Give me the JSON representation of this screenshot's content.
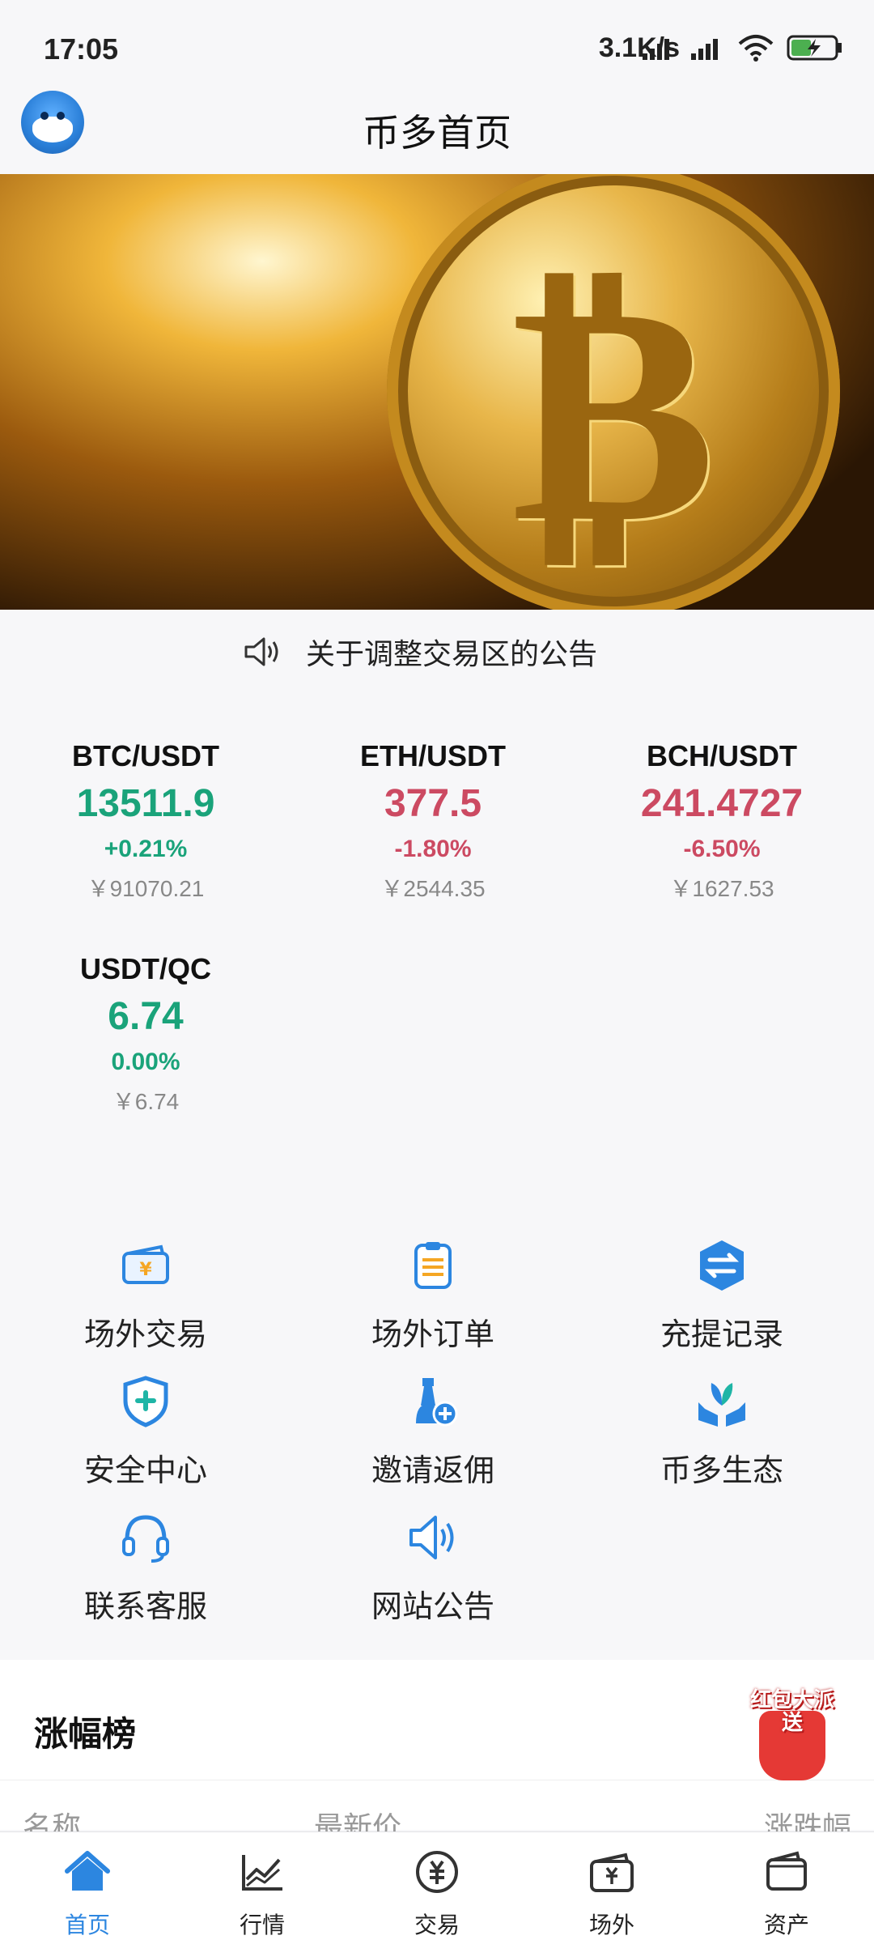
{
  "status_bar": {
    "time": "17:05",
    "net_speed": "3.1K/s"
  },
  "header": {
    "title": "币多首页",
    "avatar_icon": "mascot-avatar-icon"
  },
  "banner": {
    "image": "bitcoin-coin"
  },
  "notice": {
    "icon": "speaker-icon",
    "text": "关于调整交易区的公告"
  },
  "tickers": [
    {
      "pair": "BTC/USDT",
      "price": "13511.9",
      "change": "+0.21%",
      "cny": "￥91070.21",
      "trend": "up"
    },
    {
      "pair": "ETH/USDT",
      "price": "377.5",
      "change": "-1.80%",
      "cny": "￥2544.35",
      "trend": "down"
    },
    {
      "pair": "BCH/USDT",
      "price": "241.4727",
      "change": "-6.50%",
      "cny": "￥1627.53",
      "trend": "down"
    },
    {
      "pair": "USDT/QC",
      "price": "6.74",
      "change": "0.00%",
      "cny": "￥6.74",
      "trend": "up"
    }
  ],
  "menu": [
    {
      "label": "场外交易",
      "icon": "otc-trade-icon"
    },
    {
      "label": "场外订单",
      "icon": "otc-order-icon"
    },
    {
      "label": "充提记录",
      "icon": "deposit-withdraw-record-icon"
    },
    {
      "label": "安全中心",
      "icon": "security-center-icon"
    },
    {
      "label": "邀请返佣",
      "icon": "invite-rebate-icon"
    },
    {
      "label": "币多生态",
      "icon": "ecosystem-icon"
    },
    {
      "label": "联系客服",
      "icon": "customer-service-icon"
    },
    {
      "label": "网站公告",
      "icon": "announcement-icon"
    }
  ],
  "gainers": {
    "title": "涨幅榜",
    "columns": [
      "名称",
      "最新价",
      "涨跌幅"
    ],
    "promo": "红包大派送"
  },
  "tabbar": [
    {
      "label": "首页",
      "icon": "home-icon",
      "active": true
    },
    {
      "label": "行情",
      "icon": "market-chart-icon",
      "active": false
    },
    {
      "label": "交易",
      "icon": "trade-icon",
      "active": false
    },
    {
      "label": "场外",
      "icon": "otc-icon",
      "active": false
    },
    {
      "label": "资产",
      "icon": "wallet-icon",
      "active": false
    }
  ],
  "colors": {
    "up": "#1aa37a",
    "down": "#cc4a62",
    "accent": "#2c86e0"
  }
}
